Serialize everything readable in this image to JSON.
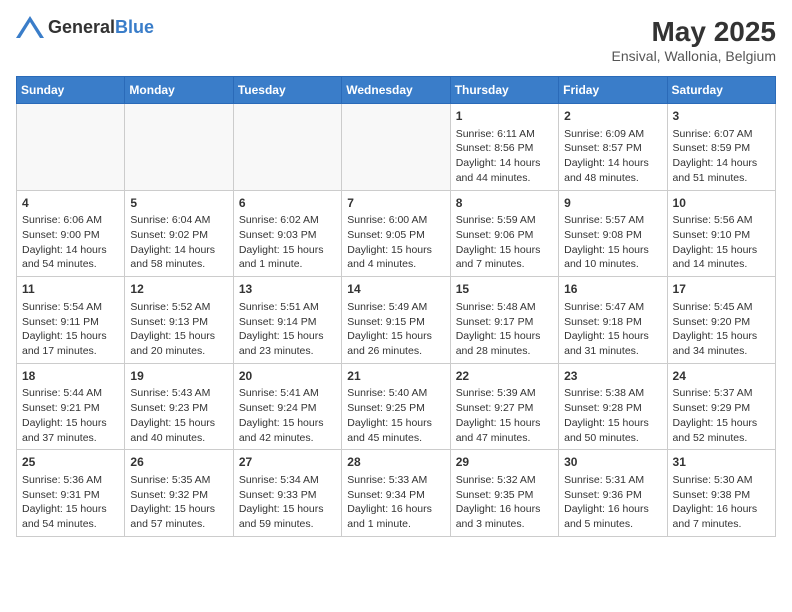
{
  "header": {
    "logo_general": "General",
    "logo_blue": "Blue",
    "month_year": "May 2025",
    "location": "Ensival, Wallonia, Belgium"
  },
  "days_of_week": [
    "Sunday",
    "Monday",
    "Tuesday",
    "Wednesday",
    "Thursday",
    "Friday",
    "Saturday"
  ],
  "weeks": [
    [
      {
        "day": "",
        "info": ""
      },
      {
        "day": "",
        "info": ""
      },
      {
        "day": "",
        "info": ""
      },
      {
        "day": "",
        "info": ""
      },
      {
        "day": "1",
        "info": "Sunrise: 6:11 AM\nSunset: 8:56 PM\nDaylight: 14 hours and 44 minutes."
      },
      {
        "day": "2",
        "info": "Sunrise: 6:09 AM\nSunset: 8:57 PM\nDaylight: 14 hours and 48 minutes."
      },
      {
        "day": "3",
        "info": "Sunrise: 6:07 AM\nSunset: 8:59 PM\nDaylight: 14 hours and 51 minutes."
      }
    ],
    [
      {
        "day": "4",
        "info": "Sunrise: 6:06 AM\nSunset: 9:00 PM\nDaylight: 14 hours and 54 minutes."
      },
      {
        "day": "5",
        "info": "Sunrise: 6:04 AM\nSunset: 9:02 PM\nDaylight: 14 hours and 58 minutes."
      },
      {
        "day": "6",
        "info": "Sunrise: 6:02 AM\nSunset: 9:03 PM\nDaylight: 15 hours and 1 minute."
      },
      {
        "day": "7",
        "info": "Sunrise: 6:00 AM\nSunset: 9:05 PM\nDaylight: 15 hours and 4 minutes."
      },
      {
        "day": "8",
        "info": "Sunrise: 5:59 AM\nSunset: 9:06 PM\nDaylight: 15 hours and 7 minutes."
      },
      {
        "day": "9",
        "info": "Sunrise: 5:57 AM\nSunset: 9:08 PM\nDaylight: 15 hours and 10 minutes."
      },
      {
        "day": "10",
        "info": "Sunrise: 5:56 AM\nSunset: 9:10 PM\nDaylight: 15 hours and 14 minutes."
      }
    ],
    [
      {
        "day": "11",
        "info": "Sunrise: 5:54 AM\nSunset: 9:11 PM\nDaylight: 15 hours and 17 minutes."
      },
      {
        "day": "12",
        "info": "Sunrise: 5:52 AM\nSunset: 9:13 PM\nDaylight: 15 hours and 20 minutes."
      },
      {
        "day": "13",
        "info": "Sunrise: 5:51 AM\nSunset: 9:14 PM\nDaylight: 15 hours and 23 minutes."
      },
      {
        "day": "14",
        "info": "Sunrise: 5:49 AM\nSunset: 9:15 PM\nDaylight: 15 hours and 26 minutes."
      },
      {
        "day": "15",
        "info": "Sunrise: 5:48 AM\nSunset: 9:17 PM\nDaylight: 15 hours and 28 minutes."
      },
      {
        "day": "16",
        "info": "Sunrise: 5:47 AM\nSunset: 9:18 PM\nDaylight: 15 hours and 31 minutes."
      },
      {
        "day": "17",
        "info": "Sunrise: 5:45 AM\nSunset: 9:20 PM\nDaylight: 15 hours and 34 minutes."
      }
    ],
    [
      {
        "day": "18",
        "info": "Sunrise: 5:44 AM\nSunset: 9:21 PM\nDaylight: 15 hours and 37 minutes."
      },
      {
        "day": "19",
        "info": "Sunrise: 5:43 AM\nSunset: 9:23 PM\nDaylight: 15 hours and 40 minutes."
      },
      {
        "day": "20",
        "info": "Sunrise: 5:41 AM\nSunset: 9:24 PM\nDaylight: 15 hours and 42 minutes."
      },
      {
        "day": "21",
        "info": "Sunrise: 5:40 AM\nSunset: 9:25 PM\nDaylight: 15 hours and 45 minutes."
      },
      {
        "day": "22",
        "info": "Sunrise: 5:39 AM\nSunset: 9:27 PM\nDaylight: 15 hours and 47 minutes."
      },
      {
        "day": "23",
        "info": "Sunrise: 5:38 AM\nSunset: 9:28 PM\nDaylight: 15 hours and 50 minutes."
      },
      {
        "day": "24",
        "info": "Sunrise: 5:37 AM\nSunset: 9:29 PM\nDaylight: 15 hours and 52 minutes."
      }
    ],
    [
      {
        "day": "25",
        "info": "Sunrise: 5:36 AM\nSunset: 9:31 PM\nDaylight: 15 hours and 54 minutes."
      },
      {
        "day": "26",
        "info": "Sunrise: 5:35 AM\nSunset: 9:32 PM\nDaylight: 15 hours and 57 minutes."
      },
      {
        "day": "27",
        "info": "Sunrise: 5:34 AM\nSunset: 9:33 PM\nDaylight: 15 hours and 59 minutes."
      },
      {
        "day": "28",
        "info": "Sunrise: 5:33 AM\nSunset: 9:34 PM\nDaylight: 16 hours and 1 minute."
      },
      {
        "day": "29",
        "info": "Sunrise: 5:32 AM\nSunset: 9:35 PM\nDaylight: 16 hours and 3 minutes."
      },
      {
        "day": "30",
        "info": "Sunrise: 5:31 AM\nSunset: 9:36 PM\nDaylight: 16 hours and 5 minutes."
      },
      {
        "day": "31",
        "info": "Sunrise: 5:30 AM\nSunset: 9:38 PM\nDaylight: 16 hours and 7 minutes."
      }
    ]
  ]
}
